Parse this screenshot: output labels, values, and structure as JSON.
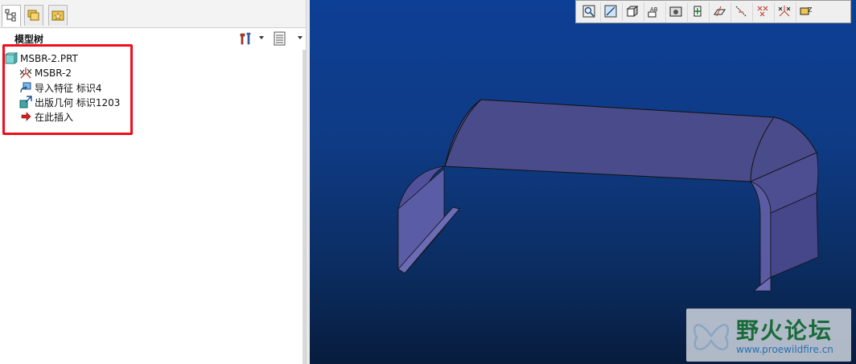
{
  "tabs": [
    {
      "icon": "model-tree-icon",
      "active": true
    },
    {
      "icon": "folder-browser-icon",
      "active": false
    },
    {
      "icon": "favorites-icon",
      "active": false
    }
  ],
  "tree_header": {
    "title": "模型树",
    "settings_icon": "tree-settings-icon",
    "show_icon": "tree-show-icon"
  },
  "tree": [
    {
      "label": "MSBR-2.PRT",
      "icon": "part-icon",
      "indent": 0
    },
    {
      "label": "MSBR-2",
      "icon": "coordinate-system-icon",
      "indent": 1
    },
    {
      "label": "导入特征 标识4",
      "icon": "import-feature-icon",
      "indent": 1
    },
    {
      "label": "出版几何 标识1203",
      "icon": "publish-geometry-icon",
      "indent": 1
    },
    {
      "label": "在此插入",
      "icon": "insert-here-arrow-icon",
      "indent": 1
    }
  ],
  "view_toolbar": [
    "zoom-fit-icon",
    "zoom-in-icon",
    "shaded-cube-icon",
    "annotation-display-icon",
    "saved-views-icon",
    "spin-center-icon",
    "datum-planes-icon",
    "datum-axes-icon",
    "datum-points-icon",
    "coordinate-systems-icon",
    "annotations-icon"
  ],
  "watermark": {
    "title": "野火论坛",
    "url": "www.proewildfire.cn"
  },
  "colors": {
    "highlight_box": "#f00d1c",
    "viewport_top": "#0d3f96",
    "viewport_bottom": "#071c3d",
    "model_face": "#4a4b8a"
  }
}
